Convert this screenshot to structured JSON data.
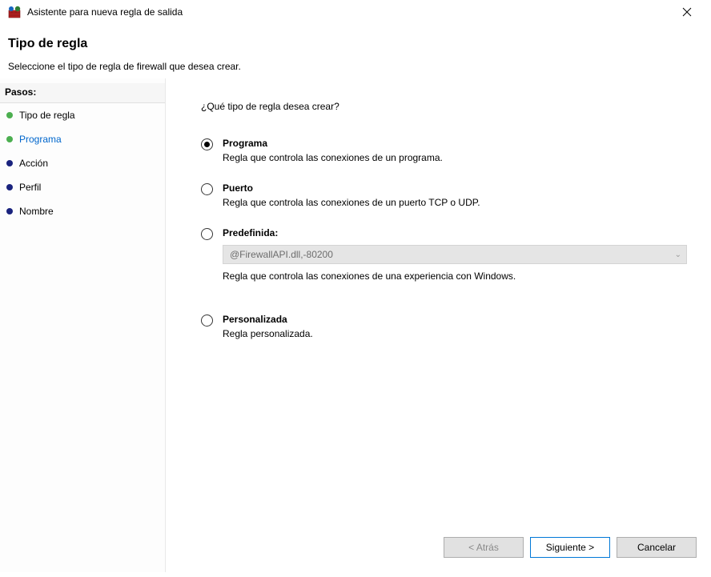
{
  "window": {
    "title": "Asistente para nueva regla de salida"
  },
  "header": {
    "title": "Tipo de regla",
    "subtitle": "Seleccione el tipo de regla de firewall que desea crear."
  },
  "sidebar": {
    "title": "Pasos:",
    "steps": [
      {
        "label": "Tipo de regla",
        "bullet": "green",
        "state": "current"
      },
      {
        "label": "Programa",
        "bullet": "green",
        "state": "active"
      },
      {
        "label": "Acción",
        "bullet": "navy",
        "state": ""
      },
      {
        "label": "Perfil",
        "bullet": "navy",
        "state": ""
      },
      {
        "label": "Nombre",
        "bullet": "navy",
        "state": ""
      }
    ]
  },
  "main": {
    "question": "¿Qué tipo de regla desea crear?",
    "options": {
      "program": {
        "title": "Programa",
        "desc": "Regla que controla las conexiones de un programa."
      },
      "port": {
        "title": "Puerto",
        "desc": "Regla que controla las conexiones de un puerto TCP o UDP."
      },
      "predefined": {
        "title": "Predefinida:",
        "combo": "@FirewallAPI.dll,-80200",
        "desc": "Regla que controla las conexiones de una experiencia con Windows."
      },
      "custom": {
        "title": "Personalizada",
        "desc": "Regla personalizada."
      }
    }
  },
  "footer": {
    "back": "< Atrás",
    "next": "Siguiente >",
    "cancel": "Cancelar"
  }
}
